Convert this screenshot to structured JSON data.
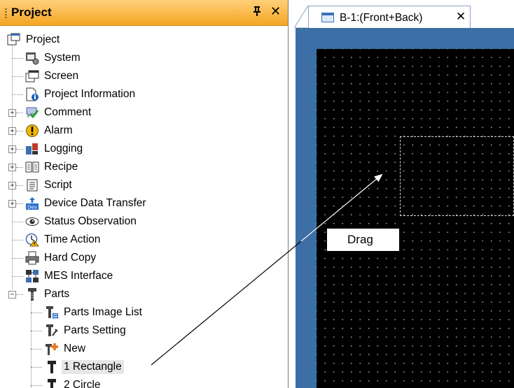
{
  "project_panel": {
    "title": "Project",
    "pin_glyph": "―¹",
    "close_glyph": "✕"
  },
  "tree": {
    "root": "Project",
    "items": [
      {
        "label": "System",
        "icon": "system-icon"
      },
      {
        "label": "Screen",
        "icon": "screen-icon"
      },
      {
        "label": "Project Information",
        "icon": "project-information-icon"
      },
      {
        "label": "Comment",
        "icon": "comment-icon"
      },
      {
        "label": "Alarm",
        "icon": "alarm-icon"
      },
      {
        "label": "Logging",
        "icon": "logging-icon"
      },
      {
        "label": "Recipe",
        "icon": "recipe-icon"
      },
      {
        "label": "Script",
        "icon": "script-icon"
      },
      {
        "label": "Device Data Transfer",
        "icon": "device-data-transfer-icon"
      },
      {
        "label": "Status Observation",
        "icon": "status-observation-icon"
      },
      {
        "label": "Time Action",
        "icon": "time-action-icon"
      },
      {
        "label": "Hard Copy",
        "icon": "hard-copy-icon"
      },
      {
        "label": "MES Interface",
        "icon": "mes-interface-icon"
      },
      {
        "label": "Parts",
        "icon": "parts-icon"
      }
    ],
    "parts_children": [
      {
        "label": "Parts Image List",
        "icon": "parts-image-list-icon"
      },
      {
        "label": "Parts Setting",
        "icon": "parts-setting-icon"
      },
      {
        "label": "New",
        "icon": "new-part-icon"
      },
      {
        "label": "1 Rectangle",
        "icon": "part-icon",
        "selected": true
      },
      {
        "label": "2 Circle",
        "icon": "part-icon"
      }
    ]
  },
  "editor": {
    "tab_label": "B-1:(Front+Back)",
    "tab_close_glyph": "✕"
  },
  "annotation": {
    "callout_text": "Drag"
  },
  "colors": {
    "panel_header": "#f5a623",
    "screen_frame": "#3c6fa6",
    "canvas": "#000000",
    "selection": "#e7e7e7"
  }
}
